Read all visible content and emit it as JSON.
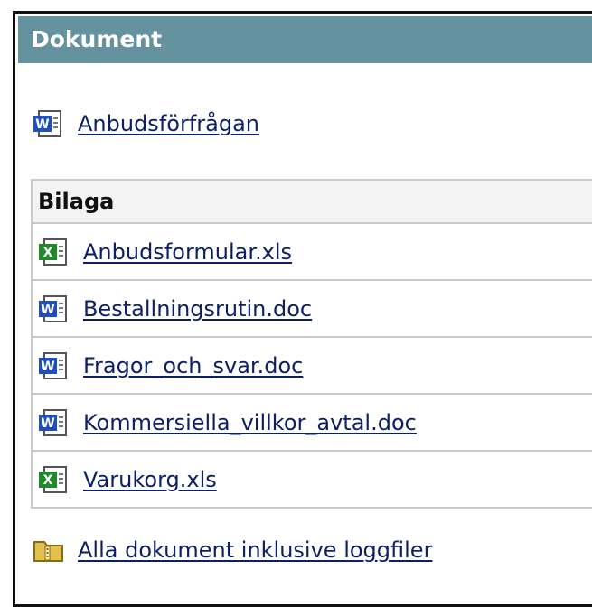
{
  "header": {
    "title": "Dokument"
  },
  "main_document": {
    "label": "Anbudsförfrågan",
    "icon": "word-doc-icon"
  },
  "attachments": {
    "heading": "Bilaga",
    "items": [
      {
        "label": "Anbudsformular.xls",
        "icon": "excel-icon"
      },
      {
        "label": "Bestallningsrutin.doc",
        "icon": "word-doc-icon"
      },
      {
        "label": "Fragor_och_svar.doc",
        "icon": "word-doc-icon"
      },
      {
        "label": "Kommersiella_villkor_avtal.doc",
        "icon": "word-doc-icon"
      },
      {
        "label": "Varukorg.xls",
        "icon": "excel-icon"
      }
    ]
  },
  "all_documents": {
    "label": "Alla dokument inklusive loggfiler",
    "icon": "zip-folder-icon"
  },
  "colors": {
    "header_bg": "#65929f",
    "link": "#0b1f66",
    "word_blue": "#1d4fbf",
    "excel_green": "#1f8a2b"
  }
}
